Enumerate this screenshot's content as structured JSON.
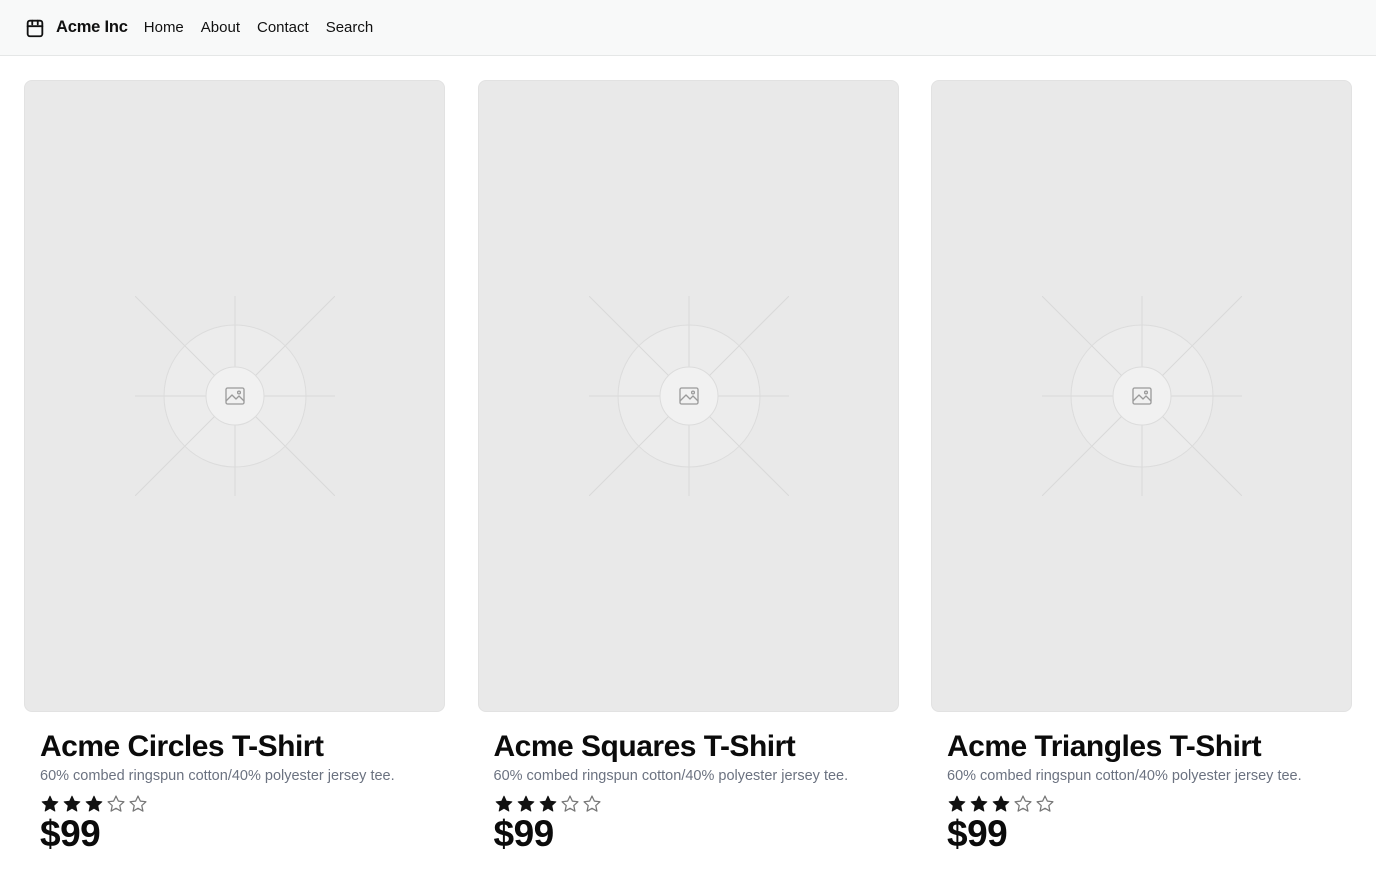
{
  "brand": {
    "name": "Acme Inc",
    "logo_icon": "shopping-bag-icon"
  },
  "nav": [
    {
      "label": "Home"
    },
    {
      "label": "About"
    },
    {
      "label": "Contact"
    },
    {
      "label": "Search"
    }
  ],
  "products": [
    {
      "title": "Acme Circles T-Shirt",
      "description": "60% combed ringspun cotton/40% polyester jersey tee.",
      "rating": 3,
      "rating_max": 5,
      "price": "$99",
      "image_icon": "image-placeholder-icon"
    },
    {
      "title": "Acme Squares T-Shirt",
      "description": "60% combed ringspun cotton/40% polyester jersey tee.",
      "rating": 3,
      "rating_max": 5,
      "price": "$99",
      "image_icon": "image-placeholder-icon"
    },
    {
      "title": "Acme Triangles T-Shirt",
      "description": "60% combed ringspun cotton/40% polyester jersey tee.",
      "rating": 3,
      "rating_max": 5,
      "price": "$99",
      "image_icon": "image-placeholder-icon"
    }
  ],
  "colors": {
    "header_bg": "#f8f9f9",
    "image_bg": "#e9e9e9",
    "text": "#111111",
    "muted_text": "#6b7280"
  }
}
